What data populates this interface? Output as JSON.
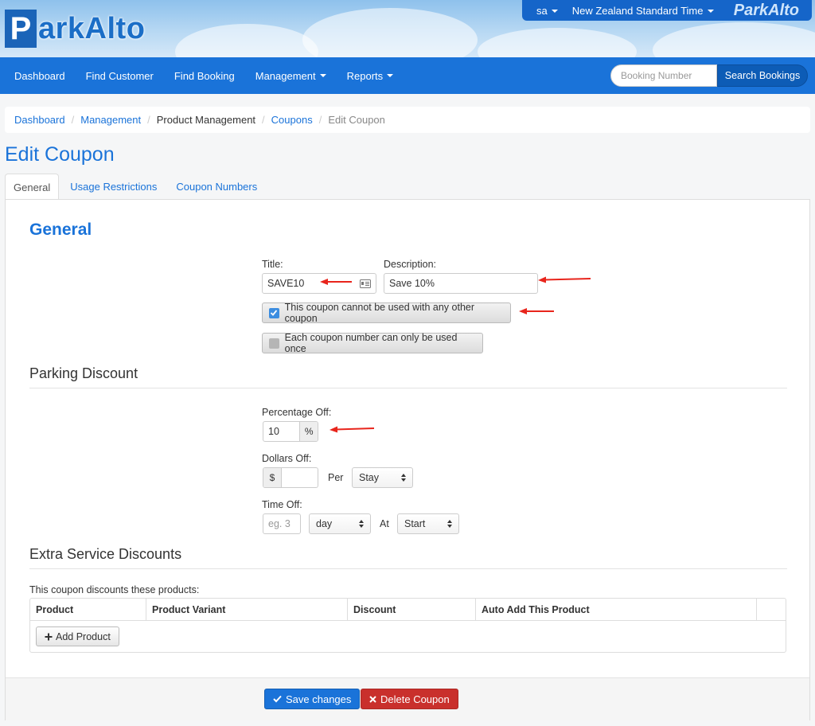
{
  "header": {
    "logo_first": "P",
    "logo_rest": "arkAlto",
    "user": "sa",
    "timezone": "New Zealand Standard Time",
    "brand": "ParkAlto"
  },
  "nav": {
    "items": [
      "Dashboard",
      "Find Customer",
      "Find Booking",
      "Management",
      "Reports"
    ],
    "search_placeholder": "Booking Number",
    "search_button": "Search Bookings"
  },
  "breadcrumb": [
    "Dashboard",
    "Management",
    "Product Management",
    "Coupons",
    "Edit Coupon"
  ],
  "page_title": "Edit Coupon",
  "tabs": [
    "General",
    "Usage Restrictions",
    "Coupon Numbers"
  ],
  "general": {
    "heading": "General",
    "title_label": "Title:",
    "title_value": "SAVE10",
    "description_label": "Description:",
    "description_value": "Save 10%",
    "check_exclusive": "This coupon cannot be used with any other coupon",
    "check_exclusive_checked": true,
    "check_once": "Each coupon number can only be used once",
    "check_once_checked": false
  },
  "parking": {
    "heading": "Parking Discount",
    "percentage_label": "Percentage Off:",
    "percentage_value": "10",
    "percentage_symbol": "%",
    "dollars_label": "Dollars Off:",
    "dollars_symbol": "$",
    "dollars_value": "",
    "per_word": "Per",
    "per_select": "Stay",
    "time_label": "Time Off:",
    "time_placeholder": "eg. 3",
    "time_unit": "day",
    "at_word": "At",
    "at_select": "Start"
  },
  "extras": {
    "heading": "Extra Service Discounts",
    "intro": "This coupon discounts these products:",
    "columns": [
      "Product",
      "Product Variant",
      "Discount",
      "Auto Add This Product",
      ""
    ],
    "add_button": "Add Product"
  },
  "actions": {
    "save": "Save changes",
    "delete": "Delete Coupon"
  },
  "colors": {
    "accent": "#1a73d9",
    "danger": "#c9302c",
    "annotation_arrow": "#e8251c"
  }
}
